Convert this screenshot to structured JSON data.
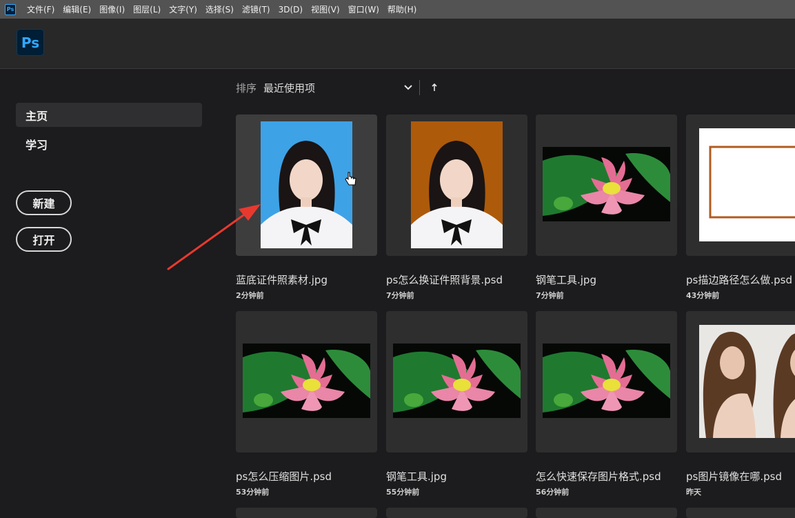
{
  "menubar": {
    "app_icon": "Ps",
    "items": [
      "文件(F)",
      "编辑(E)",
      "图像(I)",
      "图层(L)",
      "文字(Y)",
      "选择(S)",
      "滤镜(T)",
      "3D(D)",
      "视图(V)",
      "窗口(W)",
      "帮助(H)"
    ]
  },
  "header": {
    "logo": "Ps"
  },
  "sidebar": {
    "nav": [
      {
        "label": "主页",
        "active": true
      },
      {
        "label": "学习",
        "active": false
      }
    ],
    "new_button": "新建",
    "open_button": "打开"
  },
  "sort": {
    "label": "排序",
    "value": "最近使用项",
    "chevron_icon": "chevron-down-icon",
    "direction_icon": "arrow-up-icon"
  },
  "files": [
    {
      "name": "蓝底证件照素材.jpg",
      "time": "2分钟前",
      "thumb": "portrait-blue"
    },
    {
      "name": "ps怎么换证件照背景.psd",
      "time": "7分钟前",
      "thumb": "portrait-orange"
    },
    {
      "name": "钢笔工具.jpg",
      "time": "7分钟前",
      "thumb": "lotus"
    },
    {
      "name": "ps描边路径怎么做.psd",
      "time": "43分钟前",
      "thumb": "stroke-frame"
    },
    {
      "name": "ps怎么压缩图片.psd",
      "time": "53分钟前",
      "thumb": "lotus"
    },
    {
      "name": "钢笔工具.jpg",
      "time": "55分钟前",
      "thumb": "lotus"
    },
    {
      "name": "怎么快速保存图片格式.psd",
      "time": "56分钟前",
      "thumb": "lotus"
    },
    {
      "name": "ps图片镜像在哪.psd",
      "time": "昨天",
      "thumb": "mirror-woman"
    }
  ],
  "colors": {
    "menubar_bg": "#535353",
    "header_bg": "#282828",
    "app_bg": "#1c1b1d",
    "ps_blue": "#31a8ff",
    "annotation_arrow": "#e8392f"
  }
}
